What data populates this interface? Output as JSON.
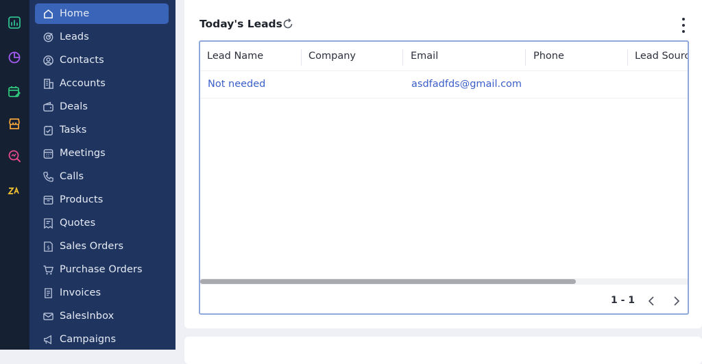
{
  "rail": {
    "icons": [
      {
        "name": "analytics-icon",
        "color": "#2fbf8f"
      },
      {
        "name": "pie-chart-icon",
        "color": "#a35cf0"
      },
      {
        "name": "calendar-edit-icon",
        "color": "#2ec47a"
      },
      {
        "name": "store-icon",
        "color": "#f3a43b"
      },
      {
        "name": "search-analytics-icon",
        "color": "#e64a8a"
      },
      {
        "name": "zoho-logo-icon",
        "color": "#f4c430"
      }
    ]
  },
  "sidebar": {
    "items": [
      {
        "label": "Home",
        "icon": "home-icon",
        "active": true
      },
      {
        "label": "Leads",
        "icon": "target-icon"
      },
      {
        "label": "Contacts",
        "icon": "contacts-icon"
      },
      {
        "label": "Accounts",
        "icon": "building-icon"
      },
      {
        "label": "Deals",
        "icon": "wallet-icon"
      },
      {
        "label": "Tasks",
        "icon": "task-icon"
      },
      {
        "label": "Meetings",
        "icon": "calendar-icon"
      },
      {
        "label": "Calls",
        "icon": "phone-icon"
      },
      {
        "label": "Products",
        "icon": "box-icon"
      },
      {
        "label": "Quotes",
        "icon": "quote-icon"
      },
      {
        "label": "Sales Orders",
        "icon": "sales-order-icon"
      },
      {
        "label": "Purchase Orders",
        "icon": "cart-icon"
      },
      {
        "label": "Invoices",
        "icon": "invoice-icon"
      },
      {
        "label": "SalesInbox",
        "icon": "inbox-icon"
      },
      {
        "label": "Campaigns",
        "icon": "megaphone-icon"
      }
    ]
  },
  "widget": {
    "title": "Today's Leads",
    "columns": [
      "Lead Name",
      "Company",
      "Email",
      "Phone",
      "Lead Source"
    ],
    "rows": [
      {
        "lead_name": "Not needed",
        "company": "",
        "email": "asdfadfds@gmail.com",
        "phone": "",
        "lead_source": ""
      }
    ],
    "pagination": {
      "range": "1 - 1"
    }
  },
  "colors": {
    "rail_bg": "#162033",
    "sidebar_bg": "#1f3560",
    "active_item": "#3a64b8",
    "link": "#3b5fc9",
    "table_border": "#8ea7dc"
  }
}
